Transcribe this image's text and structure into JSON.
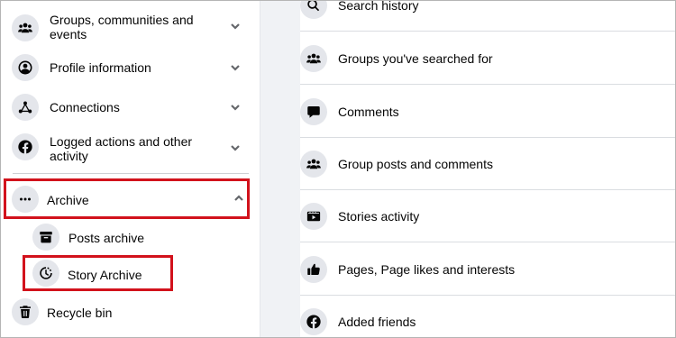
{
  "sidebar": {
    "items": [
      {
        "label_line1": "Groups, communities and",
        "label_line2": "events",
        "icon": "groups-icon"
      },
      {
        "label": "Profile information",
        "icon": "profile-icon"
      },
      {
        "label": "Connections",
        "icon": "connections-icon"
      },
      {
        "label_line1": "Logged actions and other",
        "label_line2": "activity",
        "icon": "facebook-icon"
      },
      {
        "label": "Archive",
        "icon": "more-dots-icon",
        "expanded": true
      },
      {
        "label": "Posts archive",
        "icon": "archive-box-icon"
      },
      {
        "label": "Story Archive",
        "icon": "story-clock-icon"
      },
      {
        "label": "Recycle bin",
        "icon": "trash-icon"
      }
    ]
  },
  "main": {
    "items": [
      {
        "label": "Search history",
        "icon": "search-icon"
      },
      {
        "label": "Groups you've searched for",
        "icon": "groups-icon"
      },
      {
        "label": "Comments",
        "icon": "comment-icon"
      },
      {
        "label": "Group posts and comments",
        "icon": "groups-icon"
      },
      {
        "label": "Stories activity",
        "icon": "stories-icon"
      },
      {
        "label": "Pages, Page likes and interests",
        "icon": "thumbs-up-icon"
      },
      {
        "label": "Added friends",
        "icon": "facebook-icon"
      }
    ]
  },
  "colors": {
    "highlight_box": "#d2121c",
    "icon_circle": "#e4e6eb",
    "gutter": "#f0f2f5",
    "text": "#050505"
  }
}
